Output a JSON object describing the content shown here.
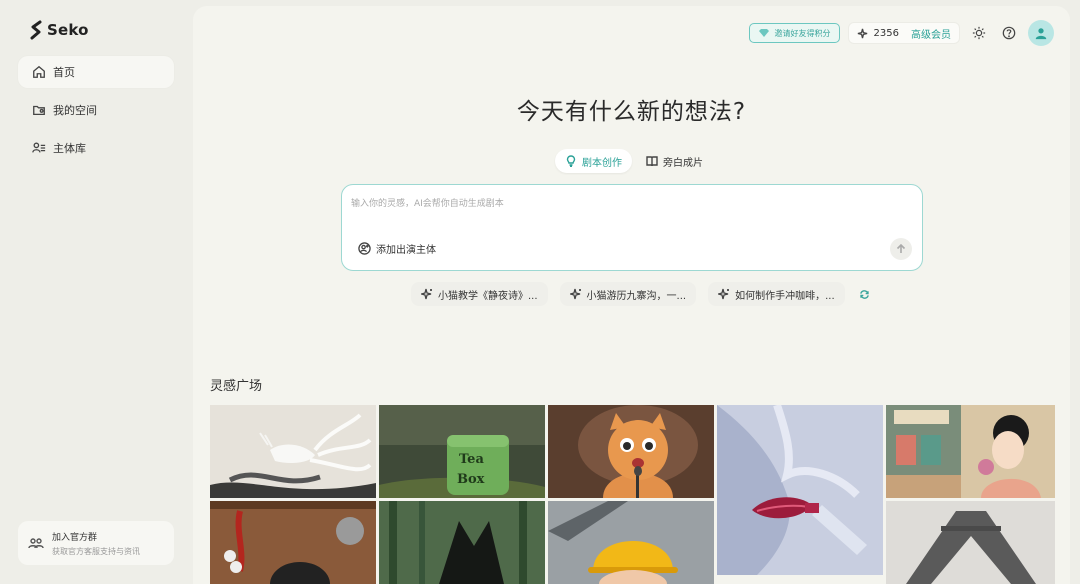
{
  "sidebar": {
    "brand": "Seko",
    "items": [
      {
        "label": "首页",
        "icon": "home-icon",
        "active": true
      },
      {
        "label": "我的空间",
        "icon": "folder-user-icon",
        "active": false
      },
      {
        "label": "主体库",
        "icon": "subject-library-icon",
        "active": false
      }
    ],
    "join": {
      "title": "加入官方群",
      "subtitle": "获取官方客服支持与资讯"
    }
  },
  "topbar": {
    "invite_label": "邀请好友得积分",
    "credits": "2356",
    "vip_label": "高级会员",
    "accent": "#2aa197"
  },
  "main": {
    "headline": "今天有什么新的想法?",
    "tabs": [
      {
        "label": "剧本创作",
        "icon": "bulb-icon",
        "active": true
      },
      {
        "label": "旁白成片",
        "icon": "book-open-icon",
        "active": false
      }
    ],
    "prompt": {
      "placeholder": "输入你的灵感，AI会帮你自动生成剧本",
      "add_actor_label": "添加出演主体"
    },
    "suggestions": [
      "小猫教学《静夜诗》...",
      "小猫游历九寨沟，一...",
      "如何制作手冲咖啡，..."
    ],
    "gallery_title": "灵感广场"
  }
}
